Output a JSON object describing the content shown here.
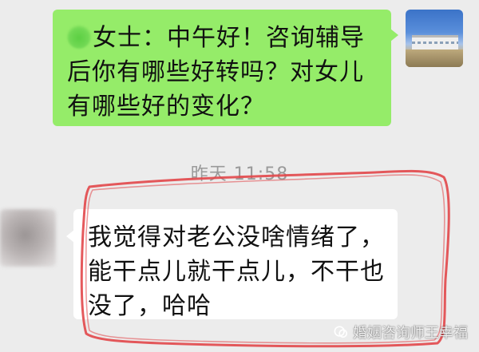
{
  "sent_message": {
    "name_redacted": "",
    "text_line1": "女士：中午好！咨询辅导",
    "text_line2": "后你有哪些好转吗？对女儿",
    "text_line3": "有哪些好的变化？"
  },
  "timestamp": "昨天 11:58",
  "received_message": {
    "text_line1": "我觉得对老公没啥情绪了，",
    "text_line2": "能干点儿就干点儿，不干也",
    "text_line3": "没了，哈哈"
  },
  "watermark": {
    "text": "婚姻咨询师王幸福",
    "icon": "wechat-official-account-icon"
  },
  "colors": {
    "sent_bubble": "#95ec69",
    "recv_bubble": "#ffffff",
    "background": "#ececec",
    "annotation": "#e2474a",
    "timestamp": "#9a9a9a"
  }
}
